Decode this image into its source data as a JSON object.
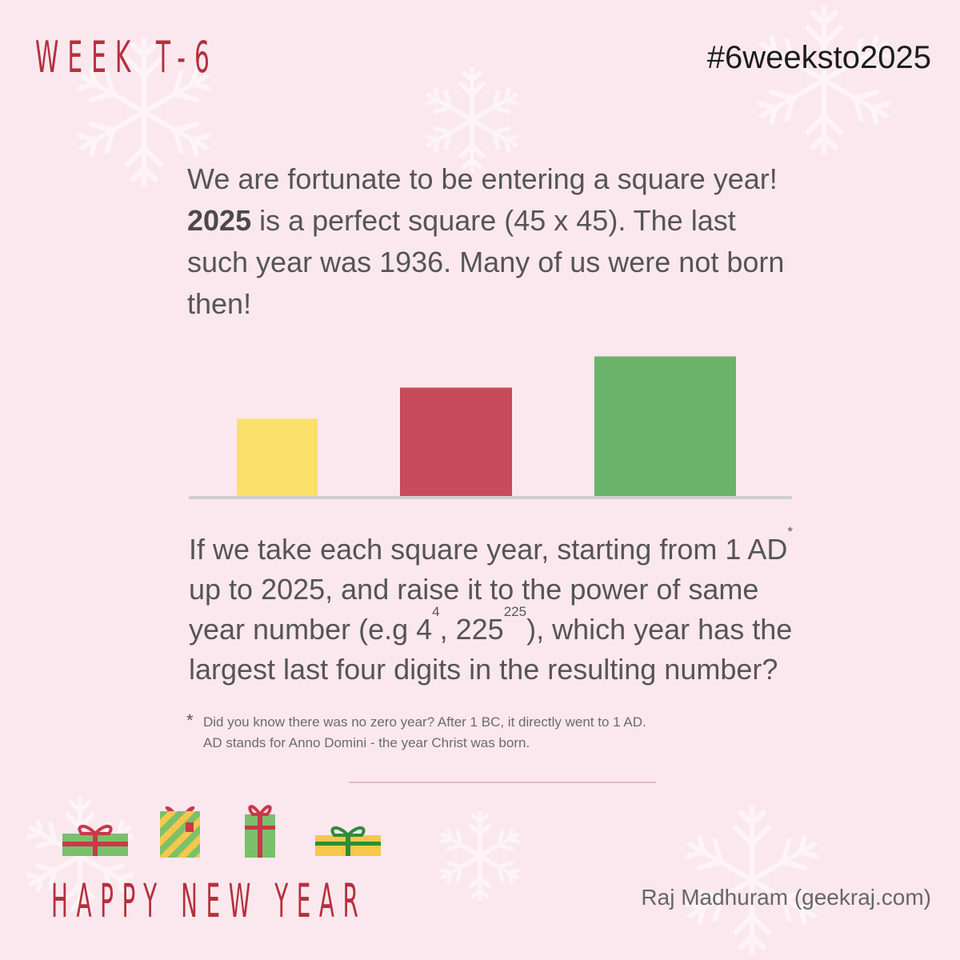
{
  "header": {
    "week_title": "WEEK T-6",
    "hashtag": "#6weeksto2025"
  },
  "intro": {
    "part1": "We are fortunate to be entering a square year! ",
    "bold_year": "2025",
    "part2": " is a perfect square (45 x 45). The last such year was 1936. Many of us were not born then!"
  },
  "chart_data": {
    "type": "bar",
    "categories": [
      "",
      "",
      ""
    ],
    "values": [
      1,
      1.4,
      1.8
    ],
    "colors": [
      "#fbe06b",
      "#c94a5b",
      "#6bb26a"
    ],
    "title": "",
    "xlabel": "",
    "ylabel": "",
    "grid": false,
    "legend": "none"
  },
  "question": {
    "line1": "If we take each square year, starting from 1 AD",
    "star": "*",
    "line2": "up to 2025, and raise it to the power of same",
    "line3_a": "year number (e.g 4",
    "exp1": "4",
    "line3_b": ", 225",
    "exp2": "225",
    "line3_c": "), which year has the",
    "line4": "largest last four digits in the resulting number?"
  },
  "footnote": {
    "star": "*",
    "line1": "Did you know there was no zero year? After 1 BC, it directly went to 1 AD.",
    "line2": "AD stands for Anno Domini - the year Christ was born."
  },
  "footer": {
    "greeting": "HAPPY NEW YEAR",
    "author": "Raj Madhuram (geekraj.com)"
  },
  "icons": [
    "snowflake-icon",
    "gift-box-icon"
  ]
}
